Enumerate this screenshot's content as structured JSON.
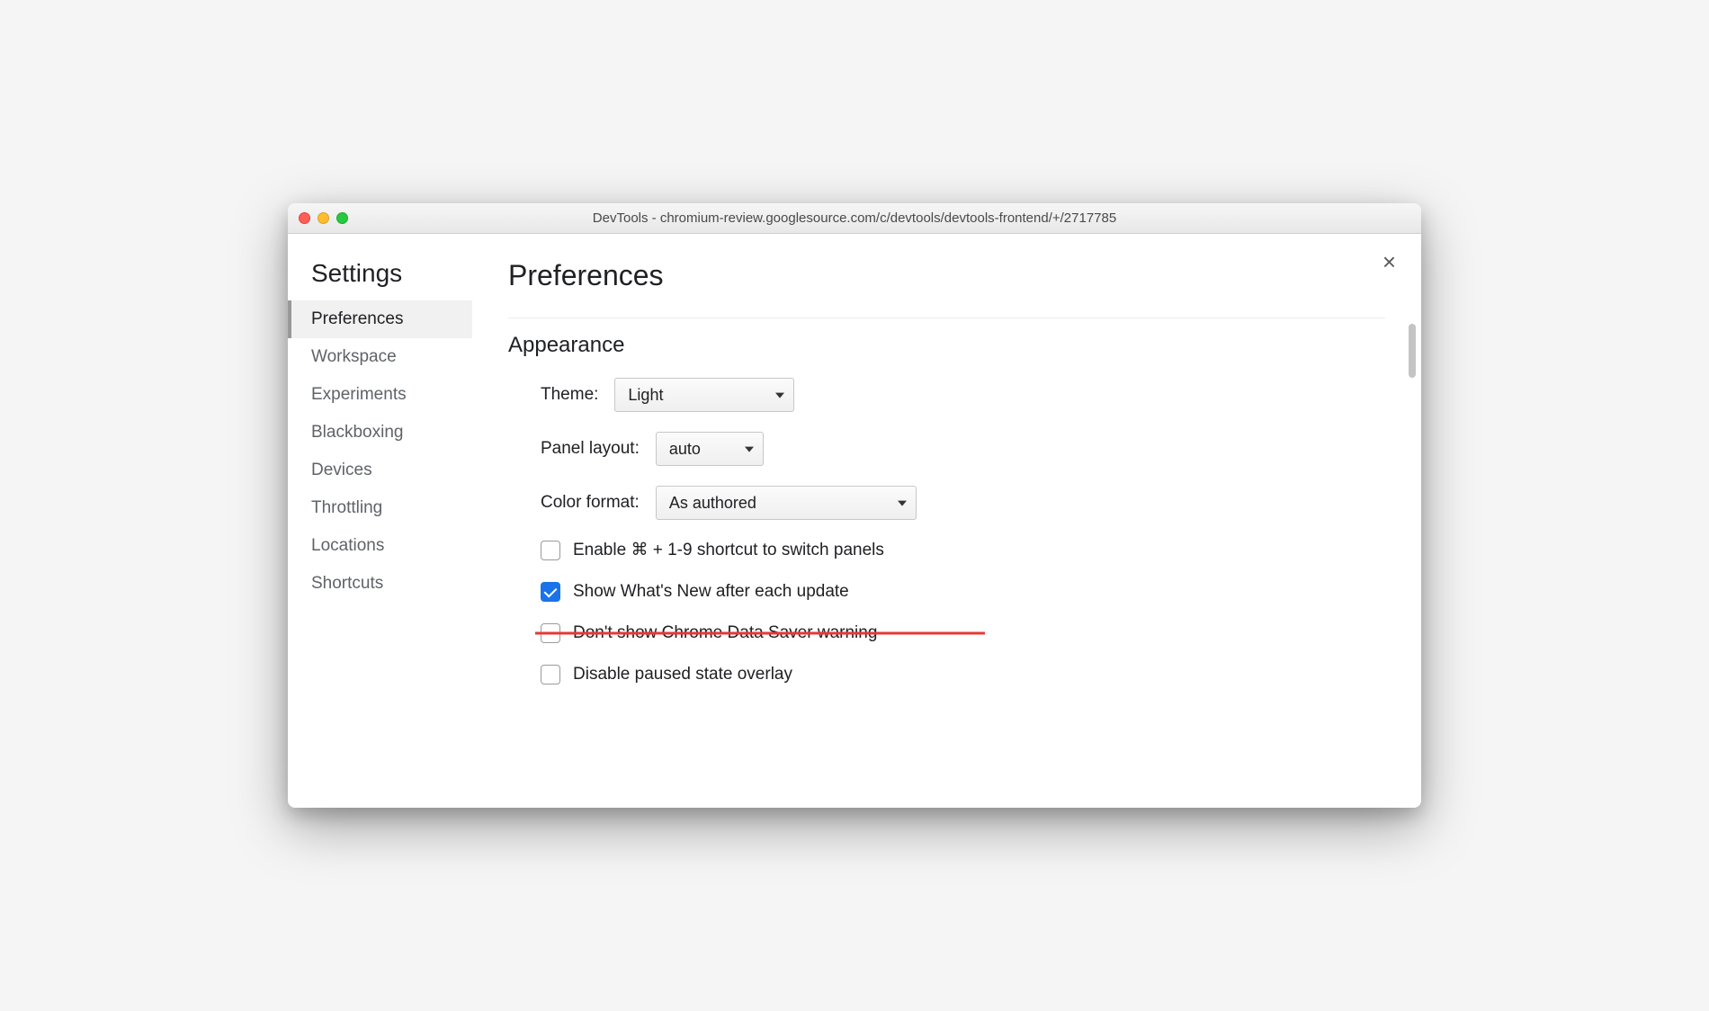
{
  "window": {
    "title": "DevTools - chromium-review.googlesource.com/c/devtools/devtools-frontend/+/2717785"
  },
  "sidebar": {
    "title": "Settings",
    "items": [
      {
        "label": "Preferences",
        "active": true
      },
      {
        "label": "Workspace",
        "active": false
      },
      {
        "label": "Experiments",
        "active": false
      },
      {
        "label": "Blackboxing",
        "active": false
      },
      {
        "label": "Devices",
        "active": false
      },
      {
        "label": "Throttling",
        "active": false
      },
      {
        "label": "Locations",
        "active": false
      },
      {
        "label": "Shortcuts",
        "active": false
      }
    ]
  },
  "main": {
    "title": "Preferences",
    "section": "Appearance",
    "close_label": "×",
    "theme": {
      "label": "Theme:",
      "value": "Light"
    },
    "panel_layout": {
      "label": "Panel layout:",
      "value": "auto"
    },
    "color_format": {
      "label": "Color format:",
      "value": "As authored"
    },
    "checkboxes": [
      {
        "label": "Enable ⌘ + 1-9 shortcut to switch panels",
        "checked": false,
        "struck": false
      },
      {
        "label": "Show What's New after each update",
        "checked": true,
        "struck": false
      },
      {
        "label": "Don't show Chrome Data Saver warning",
        "checked": false,
        "struck": true
      },
      {
        "label": "Disable paused state overlay",
        "checked": false,
        "struck": false
      }
    ]
  }
}
